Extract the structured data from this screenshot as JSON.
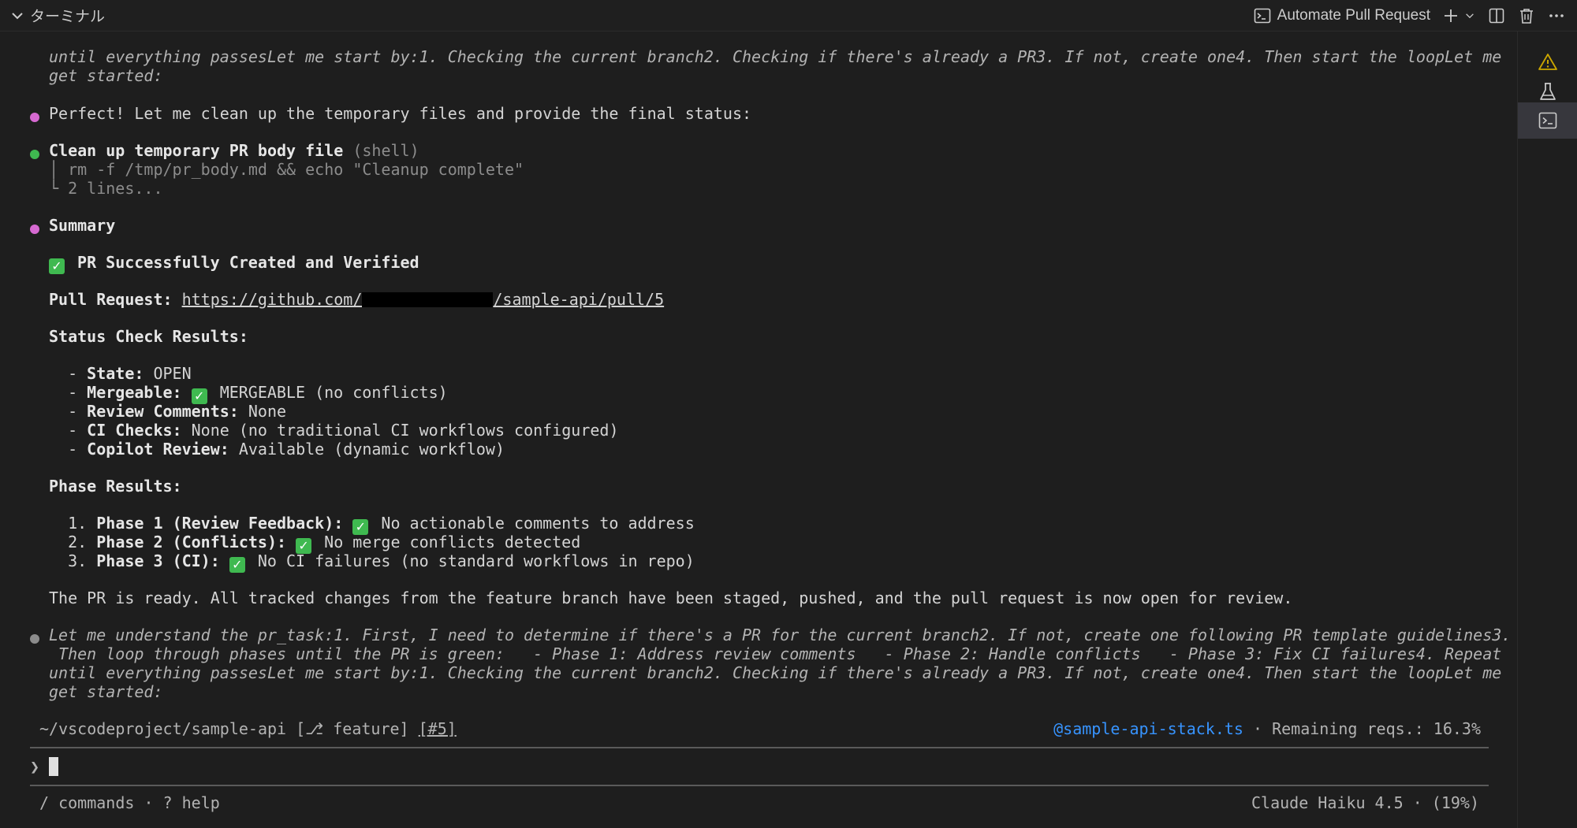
{
  "panel": {
    "title": "ターミナル",
    "terminal_name": "Automate Pull Request"
  },
  "icons": {
    "collapse": "chevron-down-icon",
    "terminal": "terminal-icon",
    "add": "plus-icon",
    "dropdown": "chevron-down-icon",
    "split": "split-icon",
    "trash": "trash-icon",
    "more": "ellipsis-icon",
    "warning": "warning-icon",
    "flask": "flask-icon",
    "terminal_tab": "terminal-icon"
  },
  "colors": {
    "background": "#1e1e1e",
    "dot_pink": "#d669d1",
    "dot_green": "#3fb950",
    "link_blue": "#3794ff",
    "warning": "#cca700"
  },
  "content": {
    "top_line1": "until everything passesLet me start by:1. Checking the current branch2. Checking if there's already a PR3. If not, create one4. Then start the loopLet me",
    "top_line2": "get started:",
    "perfect": "Perfect! Let me clean up the temporary files and provide the final status:",
    "tool_title": "Clean up temporary PR body file",
    "tool_type": "(shell)",
    "tool_cmd": "│ rm -f /tmp/pr_body.md && echo \"Cleanup complete\"",
    "tool_result": "└ 2 lines...",
    "summary": "Summary",
    "success_title": "PR Successfully Created and Verified",
    "pr_label": "Pull Request:",
    "pr_link_start": "https://github.com/",
    "pr_link_end": "/sample-api/pull/5",
    "status_heading": "Status Check Results:",
    "status_items": [
      {
        "key": "State:",
        "value": " OPEN",
        "check": false
      },
      {
        "key": "Mergeable:",
        "value": "MERGEABLE (no conflicts)",
        "check": true
      },
      {
        "key": "Review Comments:",
        "value": " None",
        "check": false
      },
      {
        "key": "CI Checks:",
        "value": " None (no traditional CI workflows configured)",
        "check": false
      },
      {
        "key": "Copilot Review:",
        "value": " Available (dynamic workflow)",
        "check": false
      }
    ],
    "phase_heading": "Phase Results:",
    "phases": [
      {
        "num": "1.",
        "label": "Phase 1 (Review Feedback):",
        "value": "No actionable comments to address"
      },
      {
        "num": "2.",
        "label": "Phase 2 (Conflicts):",
        "value": "No merge conflicts detected"
      },
      {
        "num": "3.",
        "label": "Phase 3 (CI):",
        "value": "No CI failures (no standard workflows in repo)"
      }
    ],
    "ready": "The PR is ready. All tracked changes from the feature branch have been staged, pushed, and the pull request is now open for review.",
    "thinking1": "Let me understand the pr_task:1. First, I need to determine if there's a PR for the current branch2. If not, create one following PR template guidelines3.",
    "thinking2": " Then loop through phases until the PR is green:   - Phase 1: Address review comments   - Phase 2: Handle conflicts   - Phase 3: Fix CI failures4. Repeat",
    "thinking3": "until everything passesLet me start by:1. Checking the current branch2. Checking if there's already a PR3. If not, create one4. Then start the loopLet me",
    "thinking4": "get started:"
  },
  "status_bar": {
    "path": "~/vscodeproject/sample-api",
    "branch": "[⎇ feature]",
    "pr": "[#5]",
    "file": "@sample-api-stack.ts",
    "sep": " · ",
    "remaining": "Remaining reqs.: 16.3%"
  },
  "prompt": {
    "symbol": "❯"
  },
  "footer": {
    "commands": "/ commands · ? help",
    "model": "Claude Haiku 4.5 · (19%)"
  }
}
